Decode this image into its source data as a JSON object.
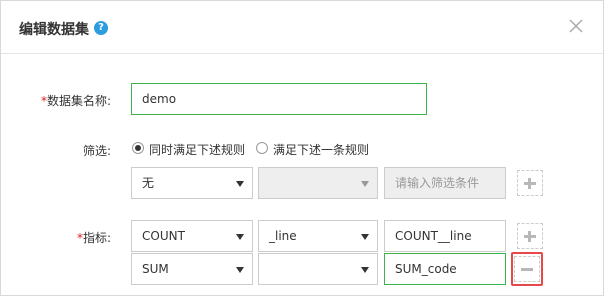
{
  "dialog": {
    "title": "编辑数据集",
    "help_icon": "?",
    "close_icon": "close-icon"
  },
  "form": {
    "name_required": "*",
    "name_label": "数据集名称:",
    "name_value": "demo",
    "filter_label": "筛选:",
    "radio_all": "同时满足下述规则",
    "radio_any": "满足下述一条规则",
    "filter_field": "无",
    "filter_operator": "",
    "filter_placeholder": "请输入筛选条件",
    "metric_required": "*",
    "metric_label": "指标:",
    "metrics": [
      {
        "func": "COUNT",
        "field": "_line",
        "alias": "COUNT__line"
      },
      {
        "func": "SUM",
        "field": "",
        "alias": "SUM_code"
      }
    ]
  }
}
